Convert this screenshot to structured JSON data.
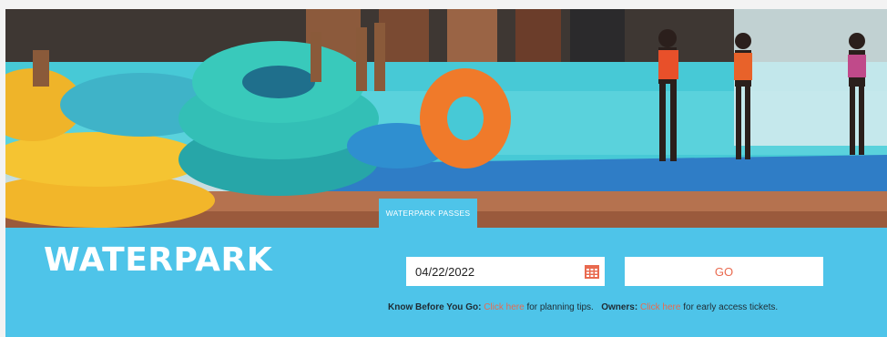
{
  "hero": {
    "tab_label": "WATERPARK PASSES"
  },
  "main": {
    "title": "WATERPARK",
    "date_value": "04/22/2022",
    "go_label": "GO"
  },
  "info": {
    "kbyg_label": "Know Before You Go:",
    "kbyg_link": "Click here",
    "kbyg_text": "for planning tips.",
    "owners_label": "Owners:",
    "owners_link": "Click here",
    "owners_text": "for early access tickets."
  },
  "colors": {
    "band": "#4ec4e9",
    "accent": "#e96a4f"
  },
  "icons": {
    "calendar": "calendar-icon"
  }
}
